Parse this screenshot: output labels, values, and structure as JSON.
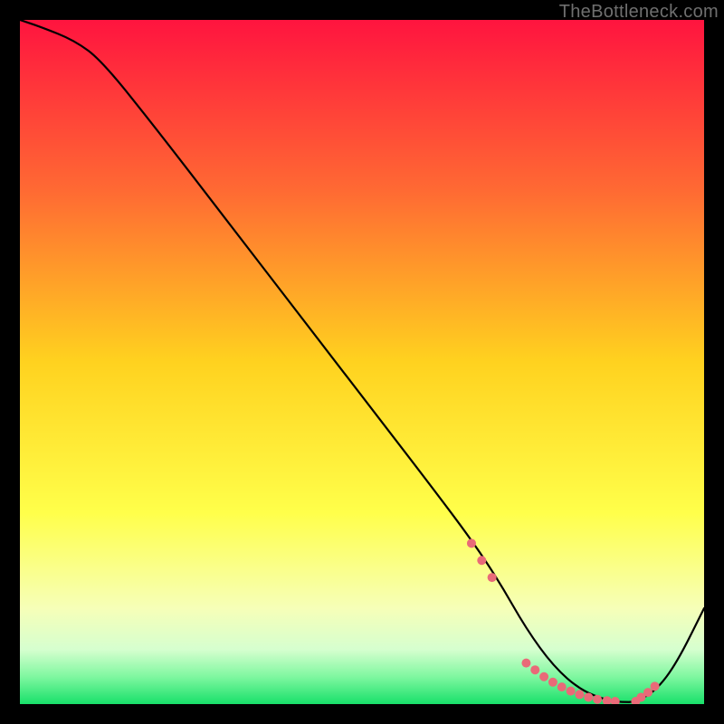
{
  "watermark": "TheBottleneck.com",
  "chart_data": {
    "type": "line",
    "title": "",
    "xlabel": "",
    "ylabel": "",
    "xlim": [
      0,
      100
    ],
    "ylim": [
      0,
      100
    ],
    "grid": false,
    "legend": false,
    "series": [
      {
        "name": "curve",
        "x": [
          0,
          3,
          8,
          12,
          20,
          30,
          40,
          50,
          60,
          66,
          70,
          74,
          78,
          82,
          86,
          88,
          90,
          93,
          96,
          100
        ],
        "y": [
          100,
          99,
          97,
          94,
          84,
          71,
          58,
          45,
          32,
          24,
          18,
          11,
          5.5,
          2.0,
          0.5,
          0.3,
          0.3,
          2.0,
          6.0,
          14
        ]
      }
    ],
    "markers": {
      "name": "dots",
      "color": "#e96a78",
      "x": [
        66.0,
        67.5,
        69.0,
        74.0,
        75.3,
        76.6,
        77.9,
        79.2,
        80.5,
        81.8,
        83.1,
        84.4,
        85.8,
        87.0,
        90.0,
        90.8,
        91.8,
        92.8
      ],
      "y": [
        23.5,
        21.0,
        18.5,
        6.0,
        5.0,
        4.0,
        3.2,
        2.5,
        1.9,
        1.4,
        1.0,
        0.7,
        0.5,
        0.4,
        0.4,
        1.0,
        1.7,
        2.6
      ]
    },
    "gradient_stops": [
      {
        "offset": 0,
        "color": "#ff143f"
      },
      {
        "offset": 25,
        "color": "#ff6a33"
      },
      {
        "offset": 50,
        "color": "#ffd21f"
      },
      {
        "offset": 72,
        "color": "#ffff4a"
      },
      {
        "offset": 86,
        "color": "#f6ffb8"
      },
      {
        "offset": 92,
        "color": "#d6ffcf"
      },
      {
        "offset": 96,
        "color": "#7ff7a0"
      },
      {
        "offset": 100,
        "color": "#18e06a"
      }
    ]
  }
}
